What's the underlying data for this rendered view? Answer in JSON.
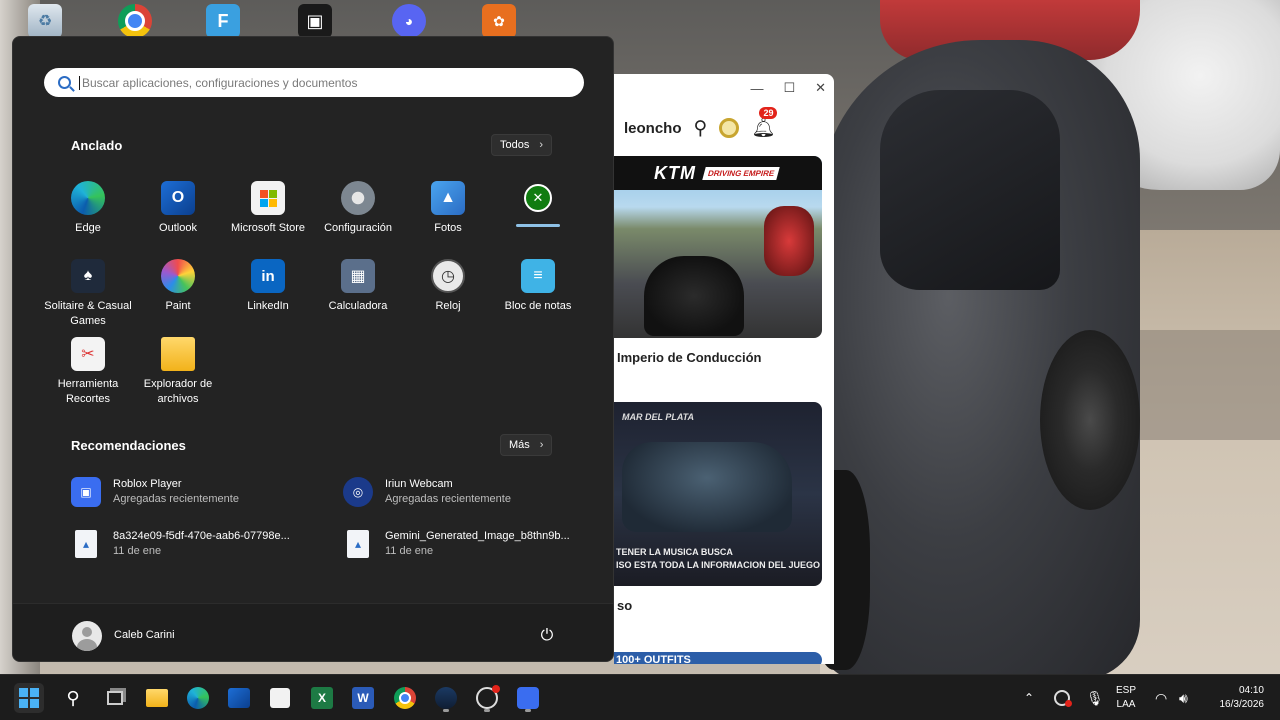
{
  "desktop": {
    "icons": [
      "recycle-bin",
      "chrome",
      "files",
      "roblox",
      "discord",
      "bear-app"
    ]
  },
  "roblox_window": {
    "username": "leoncho",
    "notification_count": "29",
    "card1": {
      "brand": "KTM",
      "tag": "DRIVING EMPIRE",
      "title": "Imperio de Conducción"
    },
    "card2": {
      "header": "MAR DEL PLATA",
      "caption_line1": "TENER LA MUSICA BUSCA",
      "caption_line2": "ISO ESTA TODA LA INFORMACION DEL JUEGO",
      "title": "so"
    },
    "card3": {
      "caption": "100+ OUTFITS"
    }
  },
  "start_menu": {
    "search_placeholder": "Buscar aplicaciones, configuraciones y documentos",
    "pinned_title": "Anclado",
    "pinned_button": "Todos",
    "pinned_apps": [
      {
        "label": "Edge"
      },
      {
        "label": "Outlook"
      },
      {
        "label": "Microsoft Store"
      },
      {
        "label": "Configuración"
      },
      {
        "label": "Fotos"
      },
      {
        "label": ""
      },
      {
        "label": "Solitaire & Casual Games"
      },
      {
        "label": "Paint"
      },
      {
        "label": "LinkedIn"
      },
      {
        "label": "Calculadora"
      },
      {
        "label": "Reloj"
      },
      {
        "label": "Bloc de notas"
      },
      {
        "label": "Herramienta Recortes"
      },
      {
        "label": "Explorador de archivos"
      }
    ],
    "recommendations_title": "Recomendaciones",
    "recommendations_button": "Más",
    "recommendations": [
      {
        "name": "Roblox Player",
        "sub": "Agregadas recientemente"
      },
      {
        "name": "Iriun Webcam",
        "sub": "Agregadas recientemente"
      },
      {
        "name": "8a324e09-f5df-470e-aab6-07798e...",
        "sub": "11 de ene"
      },
      {
        "name": "Gemini_Generated_Image_b8thn9b...",
        "sub": "11 de ene"
      }
    ],
    "user_name": "Caleb Carini"
  },
  "taskbar": {
    "lang_line1": "ESP",
    "lang_line2": "LAA",
    "time": "04:10",
    "date": "16/3/2026"
  },
  "colors": {
    "start_bg": "#232323",
    "taskbar_bg": "#1c1c1c",
    "accent": "#4ab2f5"
  }
}
